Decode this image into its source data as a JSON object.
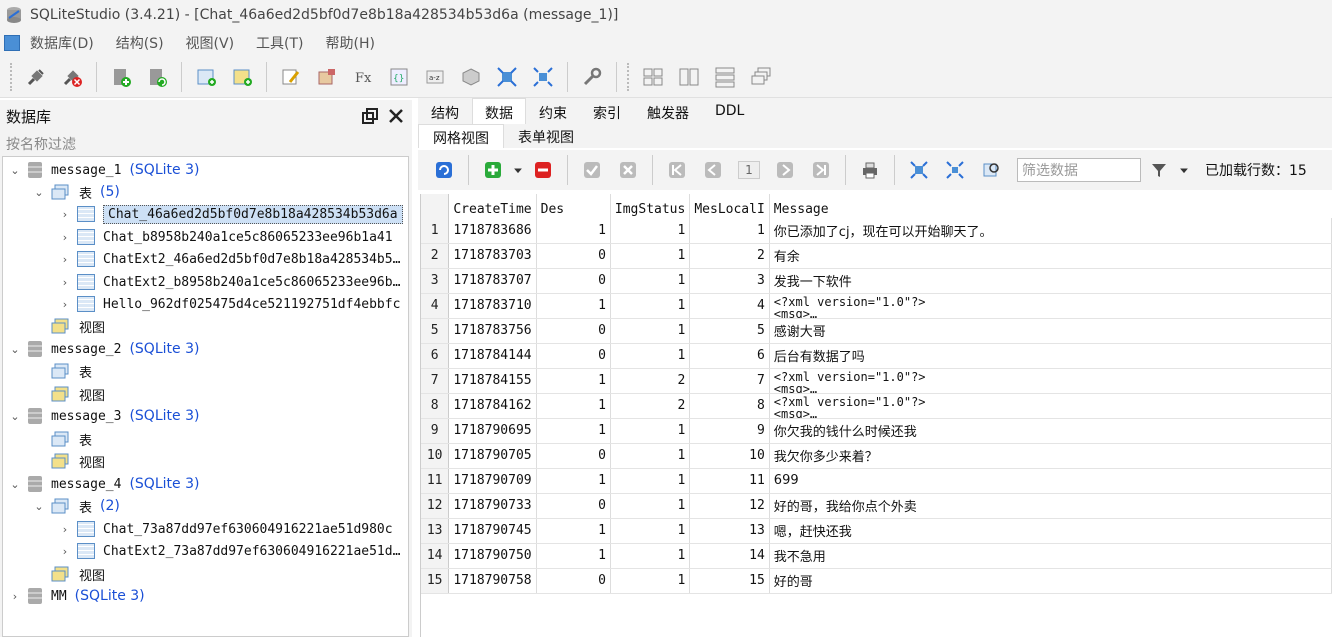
{
  "window": {
    "title": "SQLiteStudio (3.4.21) - [Chat_46a6ed2d5bf0d7e8b18a428534b53d6a (message_1)]"
  },
  "menu": [
    "数据库(D)",
    "结构(S)",
    "视图(V)",
    "工具(T)",
    "帮助(H)"
  ],
  "left_panel": {
    "title": "数据库",
    "filter_placeholder": "按名称过滤",
    "tree": {
      "db1": {
        "name": "message_1",
        "type": "(SQLite 3)",
        "tables_label": "表",
        "tables_count": "(5)",
        "tables": [
          "Chat_46a6ed2d5bf0d7e8b18a428534b53d6a",
          "Chat_b8958b240a1ce5c86065233ee96b1a41",
          "ChatExt2_46a6ed2d5bf0d7e8b18a428534b5…",
          "ChatExt2_b8958b240a1ce5c86065233ee96b…",
          "Hello_962df025475d4ce521192751df4ebbfc"
        ],
        "views_label": "视图"
      },
      "db2": {
        "name": "message_2",
        "type": "(SQLite 3)",
        "tables_label": "表",
        "views_label": "视图"
      },
      "db3": {
        "name": "message_3",
        "type": "(SQLite 3)",
        "tables_label": "表",
        "views_label": "视图"
      },
      "db4": {
        "name": "message_4",
        "type": "(SQLite 3)",
        "tables_label": "表",
        "tables_count": "(2)",
        "tables": [
          "Chat_73a87dd97ef630604916221ae51d980c",
          "ChatExt2_73a87dd97ef630604916221ae51d…"
        ],
        "views_label": "视图"
      },
      "db5": {
        "name": "MM",
        "type": "(SQLite 3)"
      }
    }
  },
  "tabs": [
    "结构",
    "数据",
    "约束",
    "索引",
    "触发器",
    "DDL"
  ],
  "subtabs": [
    "网格视图",
    "表单视图"
  ],
  "grid_toolbar": {
    "page": "1",
    "filter_placeholder": "筛选数据",
    "loaded_rows": "已加载行数：15"
  },
  "grid": {
    "columns": [
      "CreateTime",
      "Des",
      "ImgStatus",
      "MesLocalI",
      "Message"
    ],
    "rows": [
      {
        "n": "1",
        "CreateTime": "1718783686",
        "Des": "1",
        "ImgStatus": "1",
        "MesLocalID": "1",
        "Message": "你已添加了cj，现在可以开始聊天了。"
      },
      {
        "n": "2",
        "CreateTime": "1718783703",
        "Des": "0",
        "ImgStatus": "1",
        "MesLocalID": "2",
        "Message": "有余"
      },
      {
        "n": "3",
        "CreateTime": "1718783707",
        "Des": "0",
        "ImgStatus": "1",
        "MesLocalID": "3",
        "Message": "发我一下软件"
      },
      {
        "n": "4",
        "CreateTime": "1718783710",
        "Des": "1",
        "ImgStatus": "1",
        "MesLocalID": "4",
        "Message": "<?xml version=\"1.0\"?>\n<msg>…"
      },
      {
        "n": "5",
        "CreateTime": "1718783756",
        "Des": "0",
        "ImgStatus": "1",
        "MesLocalID": "5",
        "Message": "感谢大哥"
      },
      {
        "n": "6",
        "CreateTime": "1718784144",
        "Des": "0",
        "ImgStatus": "1",
        "MesLocalID": "6",
        "Message": "后台有数据了吗"
      },
      {
        "n": "7",
        "CreateTime": "1718784155",
        "Des": "1",
        "ImgStatus": "2",
        "MesLocalID": "7",
        "Message": "<?xml version=\"1.0\"?>\n<msg>…"
      },
      {
        "n": "8",
        "CreateTime": "1718784162",
        "Des": "1",
        "ImgStatus": "2",
        "MesLocalID": "8",
        "Message": "<?xml version=\"1.0\"?>\n<msg>…"
      },
      {
        "n": "9",
        "CreateTime": "1718790695",
        "Des": "1",
        "ImgStatus": "1",
        "MesLocalID": "9",
        "Message": "你欠我的钱什么时候还我"
      },
      {
        "n": "10",
        "CreateTime": "1718790705",
        "Des": "0",
        "ImgStatus": "1",
        "MesLocalID": "10",
        "Message": "我欠你多少来着？"
      },
      {
        "n": "11",
        "CreateTime": "1718790709",
        "Des": "1",
        "ImgStatus": "1",
        "MesLocalID": "11",
        "Message": "699"
      },
      {
        "n": "12",
        "CreateTime": "1718790733",
        "Des": "0",
        "ImgStatus": "1",
        "MesLocalID": "12",
        "Message": "好的哥，我给你点个外卖"
      },
      {
        "n": "13",
        "CreateTime": "1718790745",
        "Des": "1",
        "ImgStatus": "1",
        "MesLocalID": "13",
        "Message": "嗯，赶快还我"
      },
      {
        "n": "14",
        "CreateTime": "1718790750",
        "Des": "1",
        "ImgStatus": "1",
        "MesLocalID": "14",
        "Message": "我不急用"
      },
      {
        "n": "15",
        "CreateTime": "1718790758",
        "Des": "0",
        "ImgStatus": "1",
        "MesLocalID": "15",
        "Message": "好的哥"
      }
    ]
  }
}
